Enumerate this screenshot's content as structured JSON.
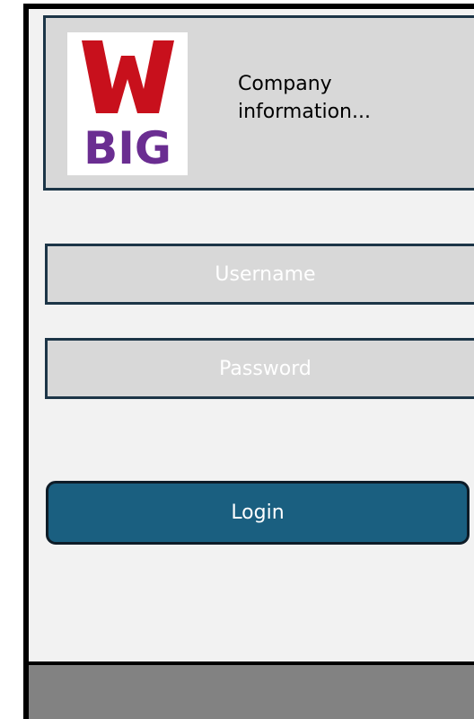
{
  "header": {
    "logo": {
      "top_text": "W",
      "bottom_text": "BIG",
      "top_color": "#c8101c",
      "bottom_color": "#6a2d91"
    },
    "company_info": "Company information..."
  },
  "login_form": {
    "username_placeholder": "Username",
    "password_placeholder": "Password",
    "login_label": "Login"
  },
  "colors": {
    "panel": "#d8d8d8",
    "border": "#1c3547",
    "button": "#1a5f80",
    "footer": "#828282",
    "background": "#f2f2f2"
  }
}
